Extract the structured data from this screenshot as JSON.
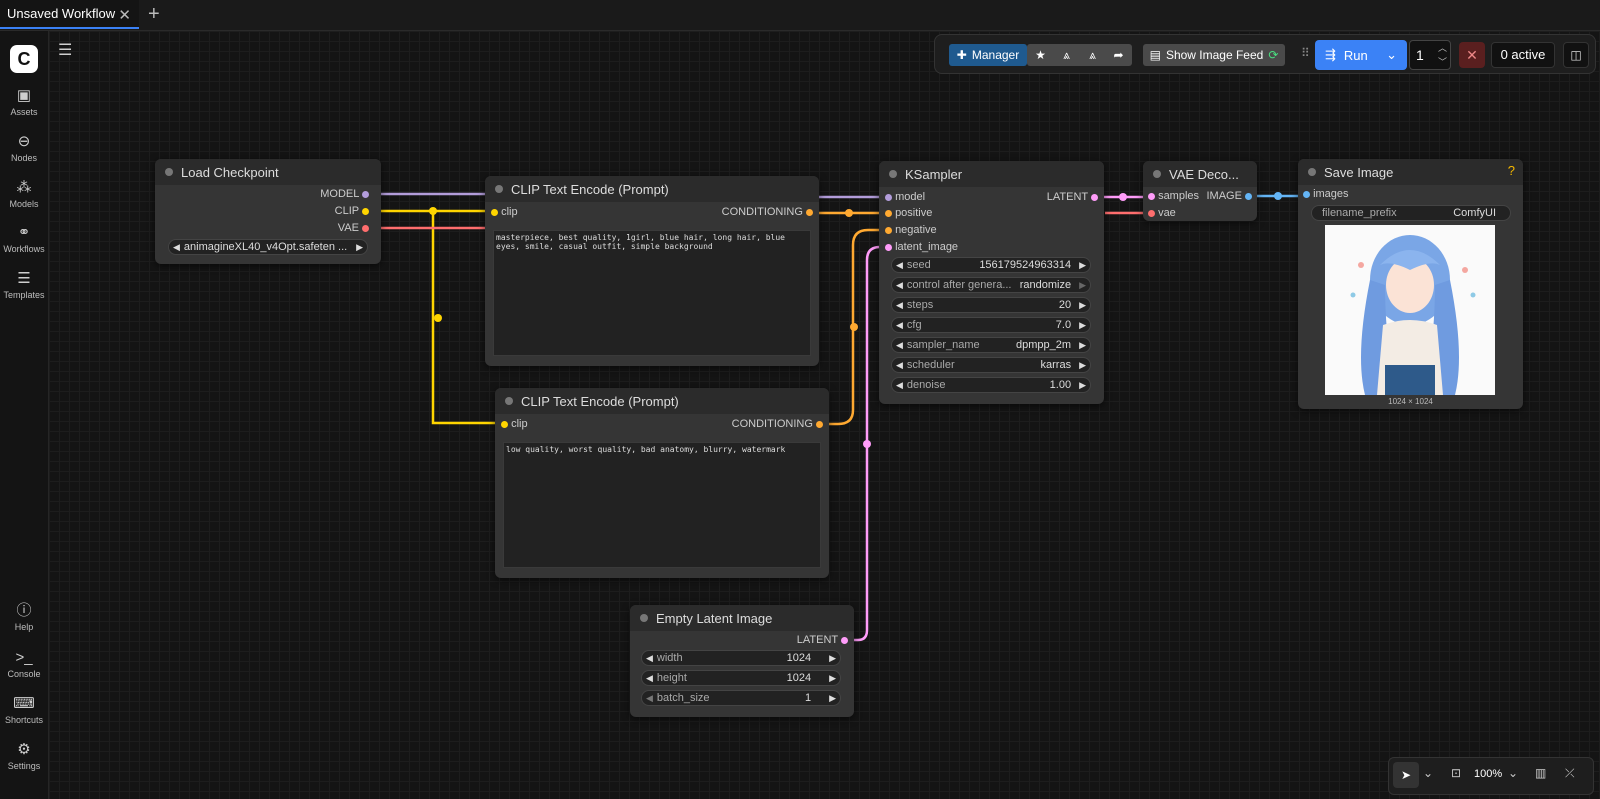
{
  "tab": {
    "title": "Unsaved Workflow"
  },
  "sidebar": {
    "items": [
      {
        "label": "Assets",
        "icon": "image-icon"
      },
      {
        "label": "Nodes",
        "icon": "nodes-icon"
      },
      {
        "label": "Models",
        "icon": "models-icon"
      },
      {
        "label": "Workflows",
        "icon": "workflows-icon"
      },
      {
        "label": "Templates",
        "icon": "templates-icon"
      }
    ],
    "bottom": [
      {
        "label": "Help",
        "icon": "help-icon"
      },
      {
        "label": "Console",
        "icon": "console-icon"
      },
      {
        "label": "Shortcuts",
        "icon": "keyboard-icon"
      },
      {
        "label": "Settings",
        "icon": "gear-icon"
      }
    ]
  },
  "toolbar": {
    "manager": "Manager",
    "image_feed": "Show Image Feed",
    "run": "Run",
    "queue_count": "1",
    "active": "0 active"
  },
  "nodes": {
    "load_checkpoint": {
      "title": "Load Checkpoint",
      "outputs": [
        "MODEL",
        "CLIP",
        "VAE"
      ],
      "ckpt_name": "animagineXL40_v4Opt.safeten ..."
    },
    "clip_pos": {
      "title": "CLIP Text Encode (Prompt)",
      "input": "clip",
      "output": "CONDITIONING",
      "text": "masterpiece, best quality, 1girl, blue hair, long hair, blue eyes, smile, casual outfit, simple background"
    },
    "clip_neg": {
      "title": "CLIP Text Encode (Prompt)",
      "input": "clip",
      "output": "CONDITIONING",
      "text": "low quality, worst quality, bad anatomy, blurry, watermark"
    },
    "ksampler": {
      "title": "KSampler",
      "inputs": [
        "model",
        "positive",
        "negative",
        "latent_image"
      ],
      "output": "LATENT",
      "widgets": [
        {
          "label": "seed",
          "value": "156179524963314"
        },
        {
          "label": "control after genera...",
          "value": "randomize"
        },
        {
          "label": "steps",
          "value": "20"
        },
        {
          "label": "cfg",
          "value": "7.0"
        },
        {
          "label": "sampler_name",
          "value": "dpmpp_2m"
        },
        {
          "label": "scheduler",
          "value": "karras"
        },
        {
          "label": "denoise",
          "value": "1.00"
        }
      ]
    },
    "vae_decode": {
      "title": "VAE Deco...",
      "inputs": [
        "samples",
        "vae"
      ],
      "output": "IMAGE"
    },
    "save_image": {
      "title": "Save Image",
      "input": "images",
      "prefix_label": "filename_prefix",
      "prefix_value": "ComfyUI",
      "resolution": "1024 × 1024",
      "help": "?"
    },
    "empty_latent": {
      "title": "Empty Latent Image",
      "output": "LATENT",
      "widgets": [
        {
          "label": "width",
          "value": "1024"
        },
        {
          "label": "height",
          "value": "1024"
        },
        {
          "label": "batch_size",
          "value": "1"
        }
      ]
    }
  },
  "zoom": {
    "level": "100%"
  },
  "colors": {
    "model": "#b39ddb",
    "clip": "#ffd500",
    "vae": "#ff6e6e",
    "conditioning": "#ffa931",
    "latent": "#ff9cf9",
    "image": "#64b5f6",
    "accent": "#3b82f6"
  }
}
